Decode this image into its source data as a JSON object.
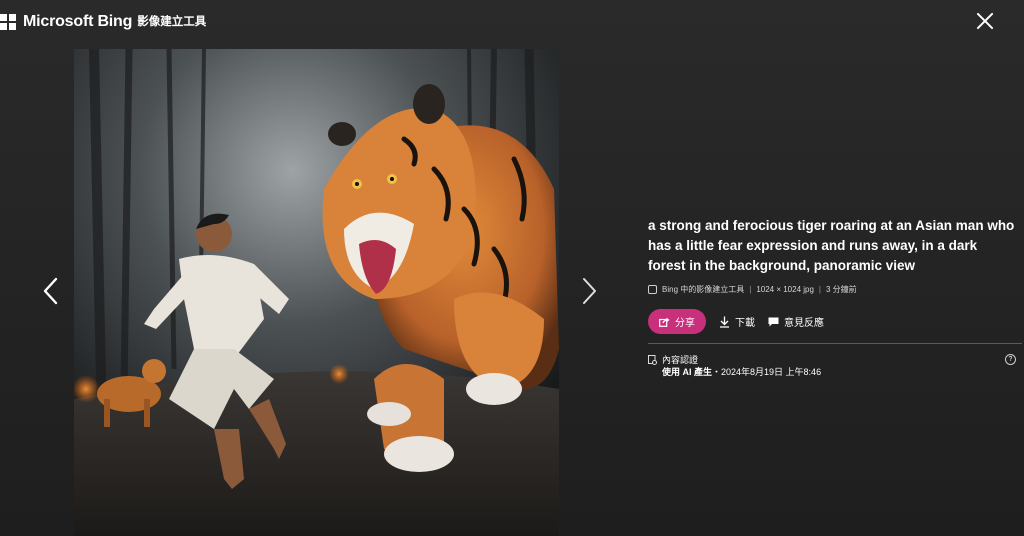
{
  "header": {
    "brand": "Microsoft Bing",
    "product": "影像建立工具",
    "icons": {
      "logo": "microsoft-logo-icon",
      "close": "close-icon"
    }
  },
  "navigation": {
    "prev_icon": "chevron-left-icon",
    "next_icon": "chevron-right-icon"
  },
  "image": {
    "subject": "tiger chasing man in forest"
  },
  "details": {
    "prompt": "a strong and ferocious tiger roaring at an Asian man who has a little fear expression and runs away, in a dark forest in the background, panoramic view",
    "source": "Bing 中的影像建立工具",
    "dimensions": "1024 × 1024 jpg",
    "time_ago": "3 分鐘前",
    "share_label": "分享",
    "download_label": "下載",
    "feedback_label": "意見反應",
    "credential_title": "內容認證",
    "credential_prefix": "使用 AI 產生",
    "credential_date": "・2024年8月19日 上午8:46",
    "help_glyph": "?"
  },
  "colors": {
    "accent": "#c8307b",
    "background": "#242424"
  }
}
